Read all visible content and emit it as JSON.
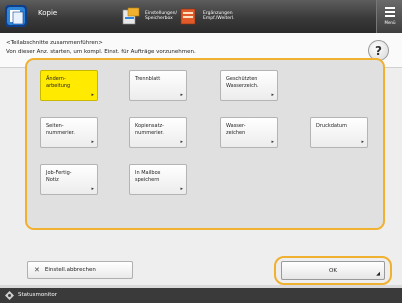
{
  "topbar": {
    "app_title": "Kopie",
    "btn1_label": "Einstellungen/ Speicherbox",
    "btn2_label": "Ergänzungen Empf./Weiterl.",
    "menu_label": "Menü"
  },
  "header": {
    "title": "<Teilabschnitte zusammenführen>",
    "description": "Von dieser Anz. starten, um kompl. Einst. für Aufträge vorzunehmen."
  },
  "buttons": [
    {
      "label": "Ändern-\narbeitung",
      "selected": true
    },
    {
      "label": "Trennblatt",
      "selected": false
    },
    {
      "label": "Geschützten\nWasserzeich.",
      "selected": false
    },
    {
      "label": "Seiten-\nnummerier.",
      "selected": false
    },
    {
      "label": "Kopiensatz-\nnummerier.",
      "selected": false
    },
    {
      "label": "Wasser-\nzeichen",
      "selected": false
    },
    {
      "label": "Druckdatum",
      "selected": false
    },
    {
      "label": "Job-Fertig-\nNotiz",
      "selected": false
    },
    {
      "label": "In Mailbox\nspeichern",
      "selected": false
    }
  ],
  "footer": {
    "cancel_label": "Einstell.abbrechen",
    "ok_label": "OK"
  },
  "status": {
    "label": "Statusmonitor"
  },
  "colors": {
    "selected": "#ffea00",
    "focus_ring": "#f0b030"
  }
}
